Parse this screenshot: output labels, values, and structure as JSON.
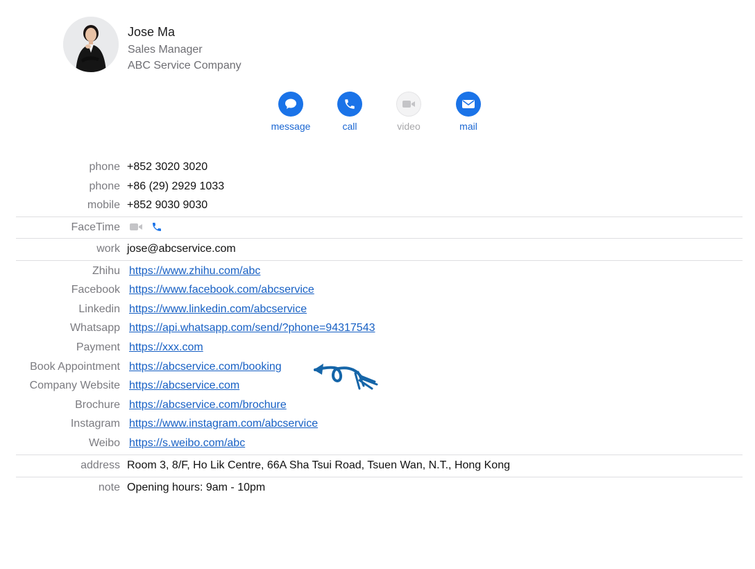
{
  "contact": {
    "name": "Jose Ma",
    "title": "Sales Manager",
    "company": "ABC Service Company"
  },
  "actions": [
    {
      "label": "message",
      "icon": "message-icon",
      "enabled": true
    },
    {
      "label": "call",
      "icon": "phone-icon",
      "enabled": true
    },
    {
      "label": "video",
      "icon": "video-icon",
      "enabled": false
    },
    {
      "label": "mail",
      "icon": "mail-icon",
      "enabled": true
    }
  ],
  "phones": [
    {
      "label": "phone",
      "value": "+852 3020 3020"
    },
    {
      "label": "phone",
      "value": "+86 (29) 2929 1033"
    },
    {
      "label": "mobile",
      "value": "+852 9030 9030"
    }
  ],
  "facetime": {
    "label": "FaceTime"
  },
  "email": {
    "label": "work",
    "value": "jose@abcservice.com"
  },
  "links": [
    {
      "label": "Zhihu",
      "value": "https://www.zhihu.com/abc"
    },
    {
      "label": "Facebook",
      "value": "https://www.facebook.com/abcservice"
    },
    {
      "label": "Linkedin",
      "value": "https://www.linkedin.com/abcservice"
    },
    {
      "label": "Whatsapp",
      "value": "https://api.whatsapp.com/send/?phone=94317543"
    },
    {
      "label": "Payment",
      "value": "https://xxx.com"
    },
    {
      "label": "Book Appointment",
      "value": "https://abcservice.com/booking"
    },
    {
      "label": "Company Website",
      "value": "https://abcservice.com"
    },
    {
      "label": "Brochure",
      "value": "https://abcservice.com/brochure"
    },
    {
      "label": "Instagram",
      "value": "https://www.instagram.com/abcservice"
    },
    {
      "label": "Weibo",
      "value": "https://s.weibo.com/abc"
    }
  ],
  "address": {
    "label": "address",
    "value": "Room 3, 8/F, Ho Lik Centre, 66A Sha Tsui Road, Tsuen Wan, N.T., Hong Kong"
  },
  "note": {
    "label": "note",
    "value": "Opening hours: 9am - 10pm"
  },
  "colors": {
    "accent": "#1a73e8",
    "link": "#1760c4",
    "annotation_arrow": "#1565a8"
  }
}
